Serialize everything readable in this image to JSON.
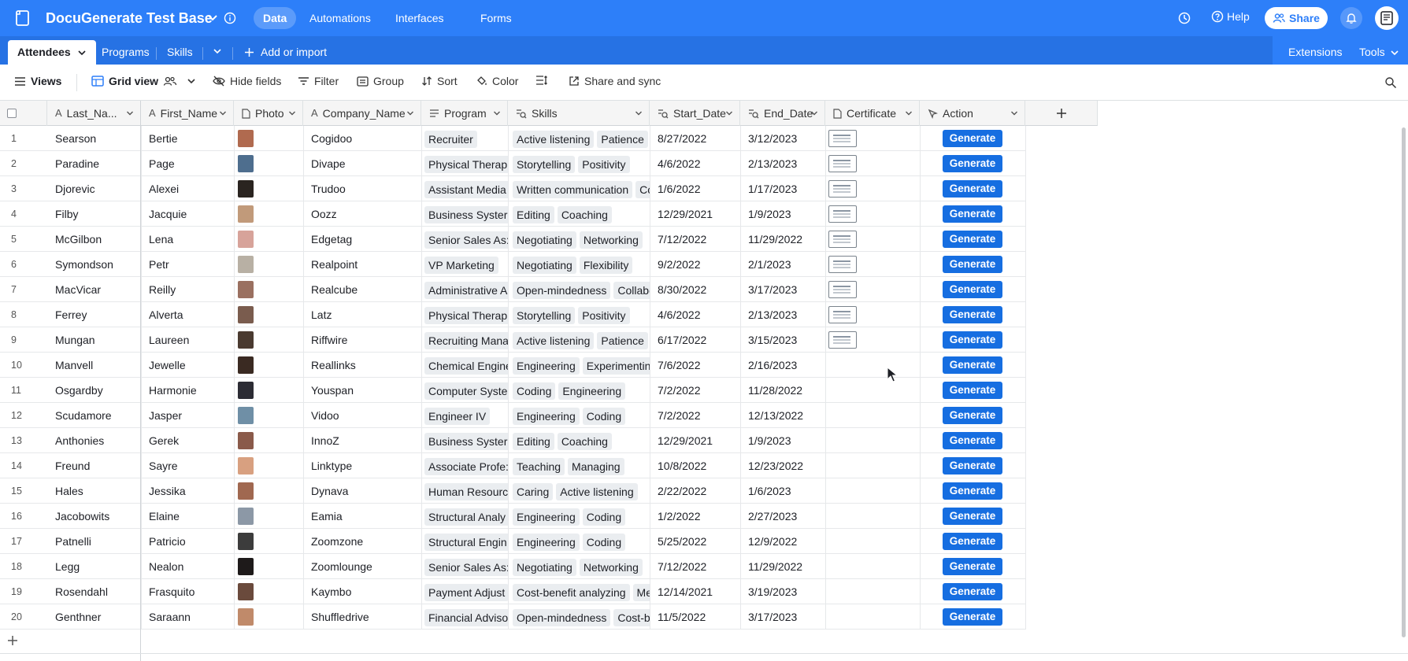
{
  "app": {
    "base_title": "DocuGenerate Test Base",
    "nav": [
      "Data",
      "Automations",
      "Interfaces",
      "Forms"
    ],
    "help": "Help",
    "share": "Share"
  },
  "tabs": {
    "items": [
      "Attendees",
      "Programs",
      "Skills"
    ],
    "add_import": "Add or import",
    "extensions": "Extensions",
    "tools": "Tools"
  },
  "toolbar": {
    "views": "Views",
    "grid_view": "Grid view",
    "hide_fields": "Hide fields",
    "filter": "Filter",
    "group": "Group",
    "sort": "Sort",
    "color": "Color",
    "share_sync": "Share and sync"
  },
  "columns": [
    "Last_Na...",
    "First_Name",
    "Photo",
    "Company_Name",
    "Program",
    "Skills",
    "Start_Date",
    "End_Date",
    "Certificate",
    "Action"
  ],
  "action_label": "Generate",
  "rows": [
    {
      "n": "1",
      "last": "Searson",
      "first": "Bertie",
      "company": "Cogidoo",
      "program": "Recruiter",
      "skills": [
        "Active listening",
        "Patience"
      ],
      "start": "8/27/2022",
      "end": "3/12/2023",
      "cert": true,
      "photo": "#b06a4f"
    },
    {
      "n": "2",
      "last": "Paradine",
      "first": "Page",
      "company": "Divape",
      "program": "Physical Therap",
      "skills": [
        "Storytelling",
        "Positivity"
      ],
      "start": "4/6/2022",
      "end": "2/13/2023",
      "cert": true,
      "photo": "#4e6e8e"
    },
    {
      "n": "3",
      "last": "Djorevic",
      "first": "Alexei",
      "company": "Trudoo",
      "program": "Assistant Media",
      "skills": [
        "Written communication",
        "Co"
      ],
      "start": "1/6/2022",
      "end": "1/17/2023",
      "cert": true,
      "photo": "#2a2420"
    },
    {
      "n": "4",
      "last": "Filby",
      "first": "Jacquie",
      "company": "Oozz",
      "program": "Business Syster",
      "skills": [
        "Editing",
        "Coaching"
      ],
      "start": "12/29/2021",
      "end": "1/9/2023",
      "cert": true,
      "photo": "#c19a7a"
    },
    {
      "n": "5",
      "last": "McGilbon",
      "first": "Lena",
      "company": "Edgetag",
      "program": "Senior Sales As:",
      "skills": [
        "Negotiating",
        "Networking"
      ],
      "start": "7/12/2022",
      "end": "11/29/2022",
      "cert": true,
      "photo": "#d7a39a"
    },
    {
      "n": "6",
      "last": "Symondson",
      "first": "Petr",
      "company": "Realpoint",
      "program": "VP Marketing",
      "skills": [
        "Negotiating",
        "Flexibility"
      ],
      "start": "9/2/2022",
      "end": "2/1/2023",
      "cert": true,
      "photo": "#b8b0a4"
    },
    {
      "n": "7",
      "last": "MacVicar",
      "first": "Reilly",
      "company": "Realcube",
      "program": "Administrative A",
      "skills": [
        "Open-mindedness",
        "Collabo"
      ],
      "start": "8/30/2022",
      "end": "3/17/2023",
      "cert": true,
      "photo": "#9a7060"
    },
    {
      "n": "8",
      "last": "Ferrey",
      "first": "Alverta",
      "company": "Latz",
      "program": "Physical Therap",
      "skills": [
        "Storytelling",
        "Positivity"
      ],
      "start": "4/6/2022",
      "end": "2/13/2023",
      "cert": true,
      "photo": "#7a5c4e"
    },
    {
      "n": "9",
      "last": "Mungan",
      "first": "Laureen",
      "company": "Riffwire",
      "program": "Recruiting Mana",
      "skills": [
        "Active listening",
        "Patience"
      ],
      "start": "6/17/2022",
      "end": "3/15/2023",
      "cert": true,
      "photo": "#4a3a30"
    },
    {
      "n": "10",
      "last": "Manvell",
      "first": "Jewelle",
      "company": "Reallinks",
      "program": "Chemical Engine",
      "skills": [
        "Engineering",
        "Experimenting"
      ],
      "start": "7/6/2022",
      "end": "2/16/2023",
      "cert": false,
      "photo": "#3a2a22"
    },
    {
      "n": "11",
      "last": "Osgardby",
      "first": "Harmonie",
      "company": "Youspan",
      "program": "Computer Syste",
      "skills": [
        "Coding",
        "Engineering"
      ],
      "start": "7/2/2022",
      "end": "11/28/2022",
      "cert": false,
      "photo": "#2c2c34"
    },
    {
      "n": "12",
      "last": "Scudamore",
      "first": "Jasper",
      "company": "Vidoo",
      "program": "Engineer IV",
      "skills": [
        "Engineering",
        "Coding"
      ],
      "start": "7/2/2022",
      "end": "12/13/2022",
      "cert": false,
      "photo": "#6f8fa6"
    },
    {
      "n": "13",
      "last": "Anthonies",
      "first": "Gerek",
      "company": "InnoZ",
      "program": "Business Syster",
      "skills": [
        "Editing",
        "Coaching"
      ],
      "start": "12/29/2021",
      "end": "1/9/2023",
      "cert": false,
      "photo": "#8a5a4a"
    },
    {
      "n": "14",
      "last": "Freund",
      "first": "Sayre",
      "company": "Linktype",
      "program": "Associate Profe:",
      "skills": [
        "Teaching",
        "Managing"
      ],
      "start": "10/8/2022",
      "end": "12/23/2022",
      "cert": false,
      "photo": "#d8a080"
    },
    {
      "n": "15",
      "last": "Hales",
      "first": "Jessika",
      "company": "Dynava",
      "program": "Human Resourc",
      "skills": [
        "Caring",
        "Active listening"
      ],
      "start": "2/22/2022",
      "end": "1/6/2023",
      "cert": false,
      "photo": "#a06850"
    },
    {
      "n": "16",
      "last": "Jacobowits",
      "first": "Elaine",
      "company": "Eamia",
      "program": "Structural Analy",
      "skills": [
        "Engineering",
        "Coding"
      ],
      "start": "1/2/2022",
      "end": "2/27/2023",
      "cert": false,
      "photo": "#8c98a6"
    },
    {
      "n": "17",
      "last": "Patnelli",
      "first": "Patricio",
      "company": "Zoomzone",
      "program": "Structural Engin",
      "skills": [
        "Engineering",
        "Coding"
      ],
      "start": "5/25/2022",
      "end": "12/9/2022",
      "cert": false,
      "photo": "#3c3c3c"
    },
    {
      "n": "18",
      "last": "Legg",
      "first": "Nealon",
      "company": "Zoomlounge",
      "program": "Senior Sales As:",
      "skills": [
        "Negotiating",
        "Networking"
      ],
      "start": "7/12/2022",
      "end": "11/29/2022",
      "cert": false,
      "photo": "#1e1a1a"
    },
    {
      "n": "19",
      "last": "Rosendahl",
      "first": "Frasquito",
      "company": "Kaymbo",
      "program": "Payment Adjust",
      "skills": [
        "Cost-benefit analyzing",
        "Me"
      ],
      "start": "12/14/2021",
      "end": "3/19/2023",
      "cert": false,
      "photo": "#6a4a3c"
    },
    {
      "n": "20",
      "last": "Genthner",
      "first": "Saraann",
      "company": "Shuffledrive",
      "program": "Financial Adviso",
      "skills": [
        "Open-mindedness",
        "Cost-be"
      ],
      "start": "11/5/2022",
      "end": "3/17/2023",
      "cert": false,
      "photo": "#c08a6a"
    }
  ]
}
